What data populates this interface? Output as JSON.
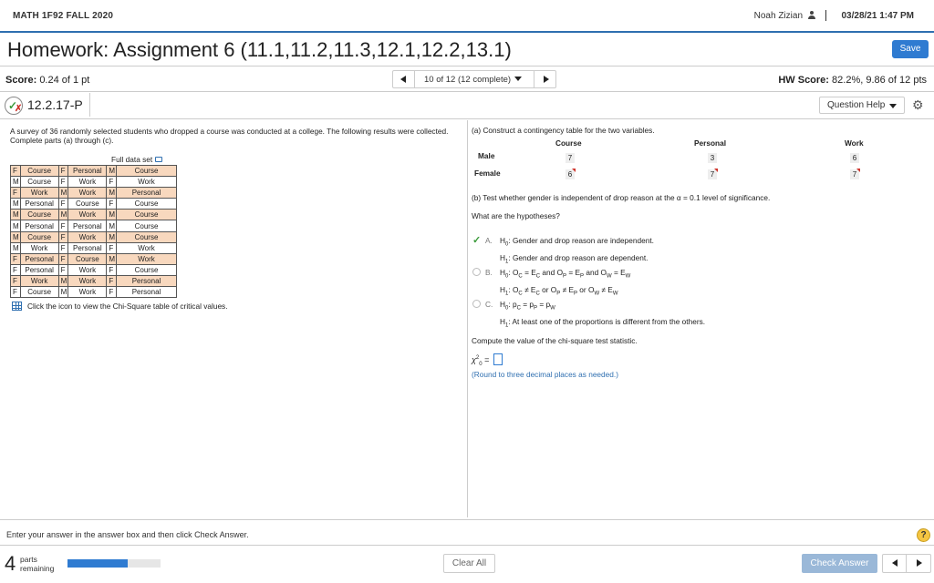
{
  "header": {
    "course": "MATH 1F92 FALL 2020",
    "user": "Noah Zizian",
    "datetime": "03/28/21 1:47 PM"
  },
  "assignment": {
    "title": "Homework: Assignment 6 (11.1,11.2,11.3,12.1,12.2,13.1)",
    "save_label": "Save"
  },
  "scorebar": {
    "score_label": "Score:",
    "score_value": "0.24 of 1 pt",
    "nav_label": "10 of 12 (12 complete)",
    "hw_score_label": "HW Score:",
    "hw_score_value": "82.2%, 9.86 of 12 pts"
  },
  "question": {
    "id": "12.2.17-P",
    "help_label": "Question Help"
  },
  "left": {
    "intro": "A survey of 36 randomly selected students who dropped a course was conducted at a college. The following results were collected. Complete parts (a) through (c).",
    "full_data_set": "Full data set",
    "rows": [
      [
        [
          "F",
          "Course"
        ],
        [
          "F",
          "Personal"
        ],
        [
          "M",
          "Course"
        ]
      ],
      [
        [
          "M",
          "Course"
        ],
        [
          "F",
          "Work"
        ],
        [
          "F",
          "Work"
        ]
      ],
      [
        [
          "F",
          "Work"
        ],
        [
          "M",
          "Work"
        ],
        [
          "M",
          "Personal"
        ]
      ],
      [
        [
          "M",
          "Personal"
        ],
        [
          "F",
          "Course"
        ],
        [
          "F",
          "Course"
        ]
      ],
      [
        [
          "M",
          "Course"
        ],
        [
          "M",
          "Work"
        ],
        [
          "M",
          "Course"
        ]
      ],
      [
        [
          "M",
          "Personal"
        ],
        [
          "F",
          "Personal"
        ],
        [
          "M",
          "Course"
        ]
      ],
      [
        [
          "M",
          "Course"
        ],
        [
          "F",
          "Work"
        ],
        [
          "M",
          "Course"
        ]
      ],
      [
        [
          "M",
          "Work"
        ],
        [
          "F",
          "Personal"
        ],
        [
          "F",
          "Work"
        ]
      ],
      [
        [
          "F",
          "Personal"
        ],
        [
          "F",
          "Course"
        ],
        [
          "M",
          "Work"
        ]
      ],
      [
        [
          "F",
          "Personal"
        ],
        [
          "F",
          "Work"
        ],
        [
          "F",
          "Course"
        ]
      ],
      [
        [
          "F",
          "Work"
        ],
        [
          "M",
          "Work"
        ],
        [
          "F",
          "Personal"
        ]
      ],
      [
        [
          "F",
          "Course"
        ],
        [
          "M",
          "Work"
        ],
        [
          "F",
          "Personal"
        ]
      ]
    ],
    "chi_link": "Click the icon to view the Chi-Square table of critical values."
  },
  "right": {
    "part_a": "(a) Construct a contingency table for the two variables.",
    "ct_columns": [
      "Course",
      "Personal",
      "Work"
    ],
    "ct_rows": [
      {
        "label": "Male",
        "values": [
          "7",
          "3",
          "6"
        ]
      },
      {
        "label": "Female",
        "values": [
          "6",
          "7",
          "7"
        ]
      }
    ],
    "part_b": "(b) Test whether gender is independent of drop reason at the α = 0.1 level of significance.",
    "hyp_q": "What are the hypotheses?",
    "options": [
      {
        "letter": "A.",
        "h0": ": Gender and drop reason are independent.",
        "h1": ": Gender and drop reason are dependent."
      },
      {
        "letter": "B."
      },
      {
        "letter": "C.",
        "h1": ": At least one of the proportions is different from the others."
      }
    ],
    "compute": "Compute the value of the chi-square test statistic.",
    "round_note": "(Round to three decimal places as needed.)"
  },
  "footer": {
    "instruction": "Enter your answer in the answer box and then click Check Answer.",
    "parts_count": "4",
    "parts_label_1": "parts",
    "parts_label_2": "remaining",
    "progress_fraction": 0.65,
    "clear_label": "Clear All",
    "check_label": "Check Answer"
  },
  "colors": {
    "accent": "#2f7bd1",
    "shade": "#f8d8be",
    "correct": "#3a9a3a",
    "incorrect": "#d0342c"
  }
}
